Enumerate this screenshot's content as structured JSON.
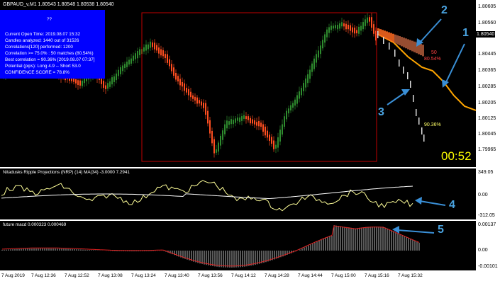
{
  "main": {
    "symbol_label": "GBPAUD_v,M1  1.80543 1.80548 1.80538 1.80540",
    "price_axis": [
      "1.80605",
      "1.80560",
      "1.80540",
      "1.80445",
      "1.80365",
      "1.80285",
      "1.80205",
      "1.80125",
      "1.80045",
      "1.79965"
    ],
    "current_price": "1.80540",
    "timer": "00:52",
    "proj_label_1": "50",
    "proj_label_2": "80.54%",
    "proj_label_3": "90.36%",
    "callouts": [
      "1",
      "2",
      "3"
    ],
    "colors": {
      "bull": "#2e8b2e",
      "bear": "#ff4e20",
      "projection_orange": "#ffa500",
      "callout": "#3a8fd6",
      "box_border": "#c00000",
      "infobox": "#0000ff"
    }
  },
  "infobox": {
    "title": "??",
    "lines": [
      "Current Open Time: 2019.08.07 15:32",
      "Candles analyzed: 1440 out of 31526",
      "Correlations[120] performed: 1200",
      "Correlation >= 75.0% : 50 matches (80.54%)",
      "Best correlation = 90.36% [2019.08.07 07:37]",
      "Potential (pips): Long 4.9 -- Short 53.0",
      "CONFIDENCE SCORE = 78.8%"
    ]
  },
  "ripple": {
    "label": "Nitadusks Ripple Projections (NRP) (14) MA(34) -3.0000 7.2941",
    "axis": [
      "349.05",
      "0.00",
      "-312.05"
    ],
    "callout": "4"
  },
  "macd": {
    "label": "future macd 0.000323 0.000469",
    "axis": [
      "0.00137",
      "0.00",
      "-0.00101"
    ],
    "callout": "5"
  },
  "timeline": [
    "7 Aug 2019",
    "7 Aug 12:36",
    "7 Aug 12:52",
    "7 Aug 13:08",
    "7 Aug 13:24",
    "7 Aug 13:40",
    "7 Aug 13:56",
    "7 Aug 14:12",
    "7 Aug 14:28",
    "7 Aug 14:44",
    "7 Aug 15:00",
    "7 Aug 15:16",
    "7 Aug 15:32"
  ]
}
